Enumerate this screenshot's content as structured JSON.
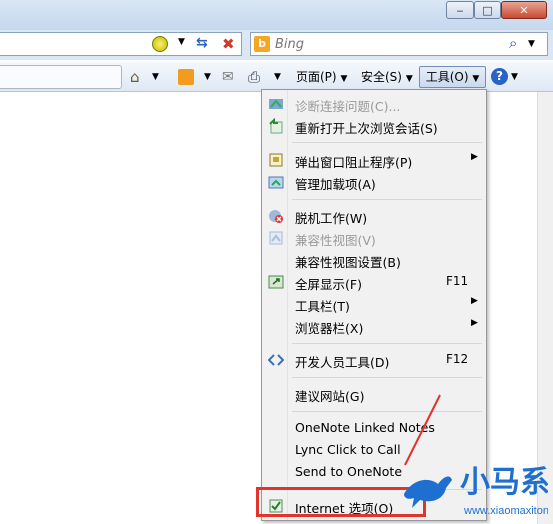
{
  "search": {
    "placeholder": "Bing"
  },
  "command_bar": {
    "page_label": "页面(P)",
    "safety_label": "安全(S)",
    "tools_label": "工具(O)"
  },
  "tools_menu": {
    "items": [
      {
        "label": "诊断连接问题(C)...",
        "icon": "diagnose-icon",
        "disabled": true
      },
      {
        "label": "重新打开上次浏览会话(S)",
        "icon": "reopen-session-icon"
      },
      {
        "label": "弹出窗口阻止程序(P)",
        "icon": "popup-blocker-icon",
        "submenu": true
      },
      {
        "label": "管理加载项(A)",
        "icon": "addons-icon"
      },
      {
        "label": "脱机工作(W)",
        "icon": "offline-icon"
      },
      {
        "label": "兼容性视图(V)",
        "icon": "compat-view-icon",
        "disabled": true
      },
      {
        "label": "兼容性视图设置(B)"
      },
      {
        "label": "全屏显示(F)",
        "icon": "fullscreen-icon",
        "shortcut": "F11"
      },
      {
        "label": "工具栏(T)",
        "submenu": true
      },
      {
        "label": "浏览器栏(X)",
        "submenu": true
      },
      {
        "label": "开发人员工具(D)",
        "icon": "developer-tools-icon",
        "shortcut": "F12"
      },
      {
        "label": "建议网站(G)"
      },
      {
        "label": "OneNote Linked Notes"
      },
      {
        "label": "Lync Click to Call"
      },
      {
        "label": "Send to OneNote"
      },
      {
        "label": "Internet 选项(O)",
        "icon": "internet-options-icon"
      }
    ]
  },
  "watermark": {
    "brand": "小马系统",
    "url": "www.xiaomaxitong.com"
  },
  "colors": {
    "highlight": "#e0342d",
    "watermark_blue": "#1f6fd0"
  }
}
